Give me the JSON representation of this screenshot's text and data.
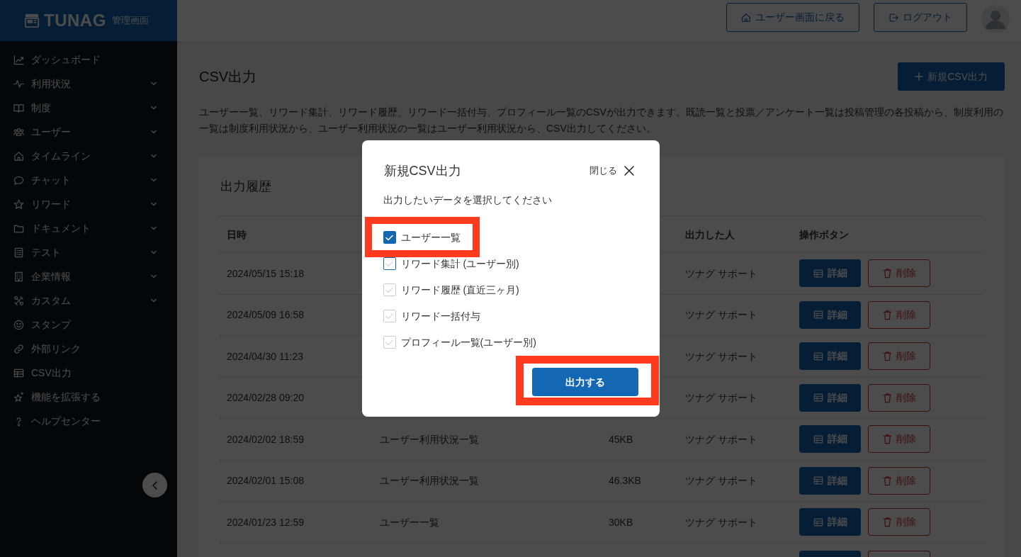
{
  "sidebar": {
    "logo": {
      "wordmark": "TUNAG",
      "caption": "管理画面"
    },
    "items": [
      {
        "label": "ダッシュボード",
        "kind": "link"
      },
      {
        "label": "利用状況",
        "kind": "group"
      },
      {
        "label": "制度",
        "kind": "group"
      },
      {
        "label": "ユーザー",
        "kind": "group"
      },
      {
        "label": "タイムライン",
        "kind": "group"
      },
      {
        "label": "チャット",
        "kind": "group"
      },
      {
        "label": "リワード",
        "kind": "group"
      },
      {
        "label": "ドキュメント",
        "kind": "group"
      },
      {
        "label": "テスト",
        "kind": "group"
      },
      {
        "label": "企業情報",
        "kind": "group"
      },
      {
        "label": "カスタム",
        "kind": "group"
      },
      {
        "label": "スタンプ",
        "kind": "link"
      },
      {
        "label": "外部リンク",
        "kind": "link"
      },
      {
        "label": "CSV出力",
        "kind": "link"
      },
      {
        "label": "機能を拡張する",
        "kind": "link"
      },
      {
        "label": "ヘルプセンター",
        "kind": "link"
      }
    ]
  },
  "header": {
    "buttons": [
      {
        "label": "ユーザー画面に戻る",
        "kind": "home"
      },
      {
        "label": "ログアウト",
        "kind": "logout"
      }
    ]
  },
  "page": {
    "title": "CSV出力",
    "new_button": "新規CSV出力",
    "description": "ユーザー一覧、リワード集計、リワード履歴、リワード一括付与、プロフィール一覧のCSVが出力できます。既読一覧と投票／アンケート一覧は投稿管理の各投稿から、制度利用の一覧は制度利用状況から、ユーザー利用状況の一覧はユーザー利用状況から、CSV出力してください。"
  },
  "history": {
    "title": "出力履歴",
    "columns": {
      "column_1": "日時",
      "column_4": "出力した人",
      "column_5": "操作ボタン"
    },
    "rows": [
      {
        "column_1": "2024/05/15 15:18",
        "column_4": "ツナグ サポート",
        "actions": {
          "detail": "詳細",
          "delete": "削除"
        }
      },
      {
        "column_1": "2024/05/09 16:58",
        "column_4": "ツナグ サポート",
        "actions": {
          "detail": "詳細",
          "delete": "削除"
        }
      },
      {
        "column_1": "2024/04/30 11:23",
        "column_4": "ツナグ サポート",
        "actions": {
          "detail": "詳細",
          "delete": "削除"
        }
      },
      {
        "column_1": "2024/02/28 09:20",
        "column_4": "ツナグ サポート",
        "actions": {
          "detail": "詳細",
          "delete": "削除"
        }
      },
      {
        "column_1": "2024/02/02 18:59",
        "column_2": "ユーザー利用状況一覧",
        "column_3": "45KB",
        "column_4": "ツナグ サポート",
        "actions": {
          "detail": "詳細",
          "delete": "削除"
        }
      },
      {
        "column_1": "2024/02/01 15:08",
        "column_2": "ユーザー利用状況一覧",
        "column_3": "46.3KB",
        "column_4": "ツナグ サポート",
        "actions": {
          "detail": "詳細",
          "delete": "削除"
        }
      },
      {
        "column_1": "2024/01/23 12:59",
        "column_2": "ユーザー一覧",
        "column_3": "30KB",
        "column_4": "ツナグ サポート",
        "actions": {
          "detail": "詳細",
          "delete": "削除"
        }
      }
    ],
    "more_rows_below": true
  },
  "dialog": {
    "title": "新規CSV出力",
    "close_label": "閉じる",
    "prompt": "出力したいデータを選択してください",
    "options": [
      {
        "label": "ユーザー一覧",
        "checked": true,
        "focused": false,
        "highlighted": true
      },
      {
        "label": "リワード集計 (ユーザー別)",
        "checked": false,
        "focused": true,
        "highlighted": false
      },
      {
        "label": "リワード履歴 (直近三ヶ月)",
        "checked": false,
        "focused": false,
        "highlighted": false
      },
      {
        "label": "リワード一括付与",
        "checked": false,
        "focused": false,
        "highlighted": false
      },
      {
        "label": "プロフィール一覧(ユーザー別)",
        "checked": false,
        "focused": false,
        "highlighted": false
      }
    ],
    "submit": {
      "label": "出力する",
      "highlighted": true
    }
  }
}
